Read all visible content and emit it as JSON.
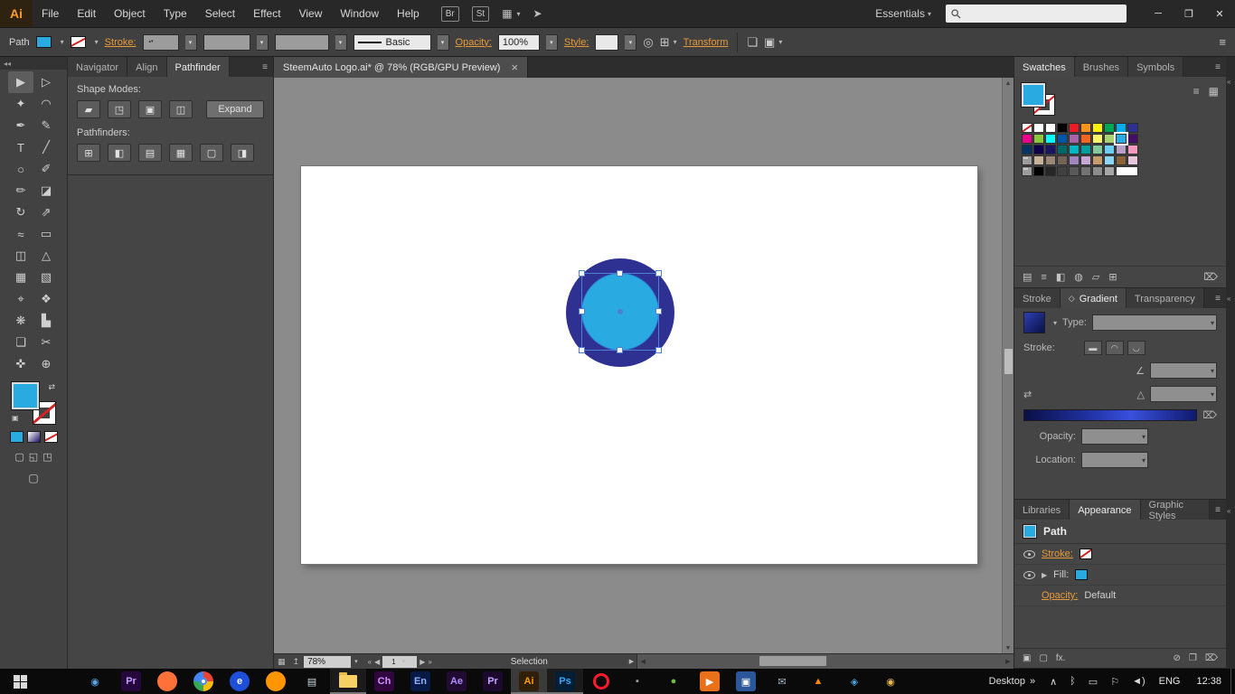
{
  "icons": {
    "caret": "▾",
    "minimize": "─",
    "restore": "❐",
    "close": "✕",
    "panel_menu": "≡",
    "dock_collapse": "◂◂",
    "edge_collapse": "«",
    "arrange_documents": "▦",
    "share": "➤",
    "recolor_artwork": "◎",
    "align_options": "⊞",
    "isolate": "❏",
    "select_similar": "▣",
    "swap_fill_stroke": "⇄",
    "default_fill_stroke": "▣",
    "screen_mode": "▢",
    "draw_normal": "▢",
    "draw_behind": "◱",
    "draw_inside": "◳",
    "list_view": "≡",
    "grid_view": "▦",
    "trash": "⌦",
    "angle": "∠",
    "aspect_ratio": "△",
    "reverse_gradient": "⇄",
    "nav_first": "«",
    "nav_prev": "◀",
    "nav_next": "▶",
    "nav_last": "»",
    "scroll_up": "▲",
    "scroll_down": "▼",
    "scroll_left": "◀",
    "scroll_right": "▶",
    "status_icon_1": "▦",
    "status_icon_2": "↥",
    "desktop_chevrons": "»",
    "gradient_tab": "◇",
    "up_down": "▴▾"
  },
  "menubar": {
    "logo": "Ai",
    "menus": [
      "File",
      "Edit",
      "Object",
      "Type",
      "Select",
      "Effect",
      "View",
      "Window",
      "Help"
    ],
    "br_button": "Br",
    "st_button": "St",
    "workspace_label": "Essentials",
    "search_value": ""
  },
  "controlbar": {
    "object_label": "Path",
    "stroke_label": "Stroke:",
    "brush_basic": "Basic",
    "opacity_label": "Opacity:",
    "opacity_value": "100%",
    "style_label": "Style:",
    "transform_label": "Transform"
  },
  "toolbar": {
    "tools": [
      {
        "name": "selection-tool",
        "glyph": "▶",
        "active": true
      },
      {
        "name": "direct-selection-tool",
        "glyph": "▷"
      },
      {
        "name": "magic-wand-tool",
        "glyph": "✦"
      },
      {
        "name": "lasso-tool",
        "glyph": "◠"
      },
      {
        "name": "pen-tool",
        "glyph": "✒"
      },
      {
        "name": "curvature-tool",
        "glyph": "✎"
      },
      {
        "name": "type-tool",
        "glyph": "T"
      },
      {
        "name": "line-segment-tool",
        "glyph": "╱"
      },
      {
        "name": "ellipse-tool",
        "glyph": "○"
      },
      {
        "name": "paintbrush-tool",
        "glyph": "✐"
      },
      {
        "name": "pencil-tool",
        "glyph": "✏"
      },
      {
        "name": "eraser-tool",
        "glyph": "◪"
      },
      {
        "name": "rotate-tool",
        "glyph": "↻"
      },
      {
        "name": "scale-tool",
        "glyph": "⇗"
      },
      {
        "name": "width-tool",
        "glyph": "≈"
      },
      {
        "name": "free-transform-tool",
        "glyph": "▭"
      },
      {
        "name": "shape-builder-tool",
        "glyph": "◫"
      },
      {
        "name": "perspective-grid-tool",
        "glyph": "△"
      },
      {
        "name": "mesh-tool",
        "glyph": "▦"
      },
      {
        "name": "gradient-tool",
        "glyph": "▧"
      },
      {
        "name": "eyedropper-tool",
        "glyph": "⌖"
      },
      {
        "name": "blend-tool",
        "glyph": "❖"
      },
      {
        "name": "symbol-sprayer-tool",
        "glyph": "❋"
      },
      {
        "name": "column-graph-tool",
        "glyph": "▙"
      },
      {
        "name": "artboard-tool",
        "glyph": "❏"
      },
      {
        "name": "slice-tool",
        "glyph": "✂"
      },
      {
        "name": "hand-tool",
        "glyph": "✜"
      },
      {
        "name": "zoom-tool",
        "glyph": "⊕"
      }
    ]
  },
  "left_panel": {
    "tabs": [
      "Navigator",
      "Align",
      "Pathfinder"
    ],
    "active_tab": "Pathfinder",
    "shape_modes_label": "Shape Modes:",
    "shape_mode_tools": [
      {
        "name": "unite",
        "glyph": "▰"
      },
      {
        "name": "minus-front",
        "glyph": "◳"
      },
      {
        "name": "intersect",
        "glyph": "▣"
      },
      {
        "name": "exclude",
        "glyph": "◫"
      }
    ],
    "expand_button": "Expand",
    "pathfinders_label": "Pathfinders:",
    "pathfinder_tools": [
      {
        "name": "divide",
        "glyph": "⊞"
      },
      {
        "name": "trim",
        "glyph": "◧"
      },
      {
        "name": "merge",
        "glyph": "▤"
      },
      {
        "name": "crop",
        "glyph": "▦"
      },
      {
        "name": "outline",
        "glyph": "▢"
      },
      {
        "name": "minus-back",
        "glyph": "◨"
      }
    ]
  },
  "document": {
    "tab_title": "SteemAuto Logo.ai* @ 78% (RGB/GPU Preview)",
    "close_glyph": "×"
  },
  "canvas": {
    "outer_circle_color": "#2e3192",
    "inner_circle_color": "#29abe2"
  },
  "statusbar": {
    "zoom_value": "78%",
    "artboard_number": "1",
    "status_text": "Selection"
  },
  "swatches_panel": {
    "tabs": [
      "Swatches",
      "Brushes",
      "Symbols"
    ],
    "active_tab": "Swatches",
    "rows": [
      [
        "none",
        "registration",
        "#ffffff",
        "#000000",
        "#ed1c24",
        "#f7941d",
        "#fff200",
        "#00a651",
        "#00aeef",
        "#2e3192"
      ],
      [
        "#ec008c",
        "#8dc63f",
        "#00ffff",
        "#0054a6",
        "#a864a8",
        "#f26522",
        "#fff568",
        "#acd373",
        "#29abe2",
        "#440e62"
      ],
      [
        "#003663",
        "#0d004c",
        "#1b1464",
        "#006666",
        "#00b7c6",
        "#009e9e",
        "#82ca9c",
        "#6dcff6",
        "#b69fc9",
        "#f49ac1"
      ],
      [
        "folder",
        "#c7b299",
        "#998675",
        "#736357",
        "#a186be",
        "#c7a7d4",
        "#c69c6d",
        "#8cd6f0",
        "#8c6239",
        "#e7c6e0"
      ],
      [
        "folder",
        "#000000",
        "#262626",
        "#404040",
        "#595959",
        "#737373",
        "#8c8c8c",
        "#a6a6a6",
        "w#ffffff"
      ]
    ],
    "selected": {
      "row": 1,
      "col": 8
    },
    "footer_icons": [
      {
        "name": "swatch-libraries-icon",
        "glyph": "▤"
      },
      {
        "name": "swatch-kinds-icon",
        "glyph": "≡"
      },
      {
        "name": "color-themes-icon",
        "glyph": "◧"
      },
      {
        "name": "edit-color-group-icon",
        "glyph": "◍"
      },
      {
        "name": "new-color-group-icon",
        "glyph": "▱"
      },
      {
        "name": "new-swatch-icon",
        "glyph": "⊞"
      },
      {
        "name": "delete-swatch-icon",
        "glyph": "⌦"
      }
    ]
  },
  "gradient_panel": {
    "tabs": [
      "Stroke",
      "Gradient",
      "Transparency"
    ],
    "active_tab": "Gradient",
    "type_label": "Type:",
    "stroke_label": "Stroke:",
    "stroke_buttons": [
      {
        "name": "gradient-stroke-within-icon",
        "glyph": "▬"
      },
      {
        "name": "gradient-stroke-along-icon",
        "glyph": "◠"
      },
      {
        "name": "gradient-stroke-across-icon",
        "glyph": "◡"
      }
    ],
    "opacity_label": "Opacity:",
    "location_label": "Location:"
  },
  "appearance_panel": {
    "tabs": [
      "Libraries",
      "Appearance",
      "Graphic Styles"
    ],
    "active_tab": "Appearance",
    "object_type": "Path",
    "stroke_label": "Stroke:",
    "fill_label": "Fill:",
    "opacity_label": "Opacity:",
    "opacity_value": "Default",
    "footer_icons": [
      {
        "name": "add-new-stroke-icon",
        "glyph": "▣"
      },
      {
        "name": "add-new-fill-icon",
        "glyph": "▢"
      },
      {
        "name": "add-new-effect-icon",
        "glyph": "fx."
      },
      {
        "name": "clear-appearance-icon",
        "glyph": "⊘",
        "right": true
      },
      {
        "name": "duplicate-item-icon",
        "glyph": "❐"
      },
      {
        "name": "delete-item-icon",
        "glyph": "⌦"
      }
    ]
  },
  "taskbar": {
    "desktop_label": "Desktop",
    "language": "ENG",
    "time": "12:38",
    "apps": [
      {
        "name": "taskbar-app-colors",
        "kind": "tiles"
      },
      {
        "name": "taskbar-app-globe",
        "letter": "◉",
        "fg": "#58a6e8"
      },
      {
        "name": "taskbar-app-premiere-rush",
        "letter": "Pr",
        "bg": "#26073c",
        "fg": "#c79bff"
      },
      {
        "name": "taskbar-app-firefox",
        "solid": true,
        "fg": "#ff7139"
      },
      {
        "name": "taskbar-app-chrome",
        "kind": "chrome"
      },
      {
        "name": "taskbar-app-edge",
        "letter": "e",
        "bg": "#1d4fd8",
        "fg": "#ffffff",
        "round": true
      },
      {
        "name": "taskbar-app-browser-orange",
        "solid": true,
        "fg": "#ff9500"
      },
      {
        "name": "taskbar-app-notepad",
        "letter": "▤",
        "fg": "#cfd8dc"
      },
      {
        "name": "taskbar-app-file-explorer",
        "kind": "explorer",
        "open": true
      },
      {
        "name": "taskbar-app-character-animator",
        "letter": "Ch",
        "bg": "#31063f",
        "fg": "#d18fff"
      },
      {
        "name": "taskbar-app-encore",
        "letter": "En",
        "bg": "#071a45",
        "fg": "#8fb0ff"
      },
      {
        "name": "taskbar-app-after-effects",
        "letter": "Ae",
        "bg": "#200b33",
        "fg": "#b48cff"
      },
      {
        "name": "taskbar-app-premiere-pro",
        "letter": "Pr",
        "bg": "#1c0a2e",
        "fg": "#c9a0ff"
      },
      {
        "name": "taskbar-app-illustrator",
        "letter": "Ai",
        "bg": "#30200a",
        "fg": "#ff9a00",
        "open": true,
        "active": true
      },
      {
        "name": "taskbar-app-photoshop",
        "letter": "Ps",
        "bg": "#001e36",
        "fg": "#31a8ff",
        "open": true
      },
      {
        "name": "taskbar-app-opera",
        "ring": true,
        "fg": "#ff1b2d"
      },
      {
        "name": "taskbar-app-utility",
        "letter": "▪",
        "fg": "#9a9a9a"
      },
      {
        "name": "taskbar-app-green",
        "letter": "●",
        "fg": "#6abf4b"
      },
      {
        "name": "taskbar-app-media-player",
        "letter": "▶",
        "bg": "#e8711a",
        "fg": "#ffffff"
      },
      {
        "name": "taskbar-app-blue-doc",
        "letter": "▣",
        "bg": "#2b579a",
        "fg": "#ffffff"
      },
      {
        "name": "taskbar-app-mail",
        "letter": "✉",
        "fg": "#9fb6c9"
      },
      {
        "name": "taskbar-app-vlc",
        "letter": "▲",
        "fg": "#ff8800"
      },
      {
        "name": "taskbar-app-blue",
        "letter": "◈",
        "fg": "#4aa3e0"
      },
      {
        "name": "taskbar-app-paint",
        "letter": "◉",
        "fg": "#e8b84a"
      }
    ],
    "tray_icons": [
      {
        "name": "hidden-icons-chevron",
        "glyph": "∧"
      },
      {
        "name": "bluetooth-icon",
        "glyph": "ᛒ"
      },
      {
        "name": "display-icon",
        "glyph": "▭"
      },
      {
        "name": "flag-icon",
        "glyph": "⚐"
      },
      {
        "name": "volume-icon",
        "glyph": "◄)"
      }
    ]
  }
}
